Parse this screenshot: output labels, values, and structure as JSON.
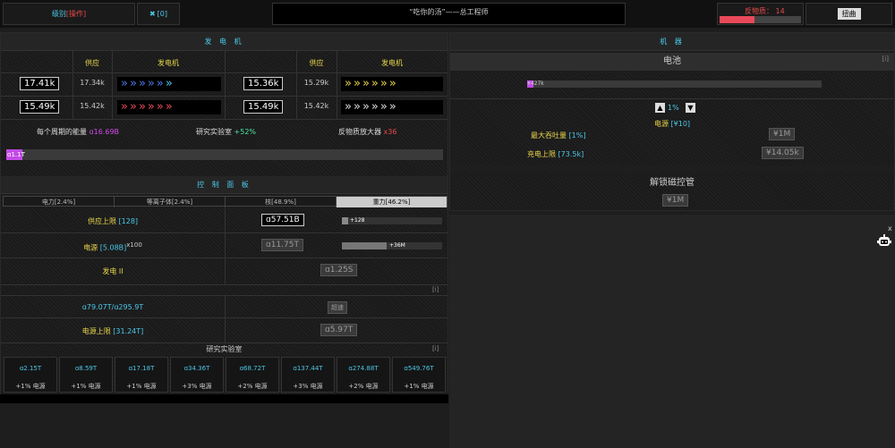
{
  "topbar": {
    "level": "级别",
    "level_action": "[操作]",
    "icon_count": "[0]",
    "quote": "“吃你的汤”——总工程师",
    "antimatter_label": "反物质：",
    "antimatter_value": "14",
    "antimatter_fill": 0.43,
    "twist_button": "扭曲"
  },
  "generators": {
    "title": "发 电 机",
    "col_supply": "供应",
    "col_generator": "发电机",
    "left": [
      {
        "box": "17.41k",
        "supply": "17.34k",
        "color": "cyan"
      },
      {
        "box": "15.49k",
        "supply": "15.42k",
        "color": "red"
      }
    ],
    "right": [
      {
        "box": "15.36k",
        "supply": "15.29k",
        "color": "yellow"
      },
      {
        "box": "15.49k",
        "supply": "15.42k",
        "color": "white"
      }
    ],
    "energy_label": "每个周期的能量",
    "energy_value": "ɑ16.69B",
    "lab_label": "研究实验室",
    "lab_value": "+52%",
    "amp_label": "反物质放大器",
    "amp_value": "x36",
    "progress_label": "ɑ1.1T"
  },
  "control": {
    "title": "控 制 面 板",
    "tabs": [
      "电力[2.4%]",
      "等离子体[2.4%]",
      "核[48.9%]",
      "重力[46.2%]"
    ],
    "supply_limit_label": "供应上限",
    "supply_limit_bracket": "[128]",
    "supply_limit_value": "ɑ57.51B",
    "supply_bar_label": "+128",
    "power_label": "电源",
    "power_bracket": "[5.08B]",
    "power_mult": "x100",
    "power_value": "ɑ11.75T",
    "power_bar_label": "+36M",
    "gen2_label": "发电 II",
    "gen2_value": "ɑ1.25S",
    "info_i": "[i]",
    "ratio": "ɑ79.07T/ɑ295.9T",
    "ratio_btn": "超速",
    "power_limit_label": "电源上限",
    "power_limit_bracket": "[31.24T]",
    "power_limit_value": "ɑ5.97T",
    "lab_title": "研究实验室",
    "lab_info": "[i]",
    "labs": [
      {
        "cost": "ɑ2.15T",
        "bonus": "+1% 电源"
      },
      {
        "cost": "ɑ8.59T",
        "bonus": "+1% 电源"
      },
      {
        "cost": "ɑ17.18T",
        "bonus": "+1% 电源"
      },
      {
        "cost": "ɑ34.36T",
        "bonus": "+3% 电源"
      },
      {
        "cost": "ɑ68.72T",
        "bonus": "+2% 电源"
      },
      {
        "cost": "ɑ137.44T",
        "bonus": "+3% 电源"
      },
      {
        "cost": "ɑ274.88T",
        "bonus": "+2% 电源"
      },
      {
        "cost": "ɑ549.76T",
        "bonus": "+1% 电源"
      }
    ]
  },
  "machines": {
    "title": "机 器",
    "battery_title": "电池",
    "battery_info": "[i]",
    "battery_bar_label": "¥427k",
    "pct": "1%",
    "power_label": "电源",
    "power_bracket": "[¥10]",
    "max_label": "最大吞吐量",
    "max_bracket": "[1%]",
    "max_value": "¥1M",
    "charge_label": "充电上限",
    "charge_bracket": "[73.5k]",
    "charge_value": "¥14.05k",
    "unlock_title": "解锁磁控管",
    "unlock_value": "¥1M"
  },
  "side": {
    "close": "x"
  }
}
